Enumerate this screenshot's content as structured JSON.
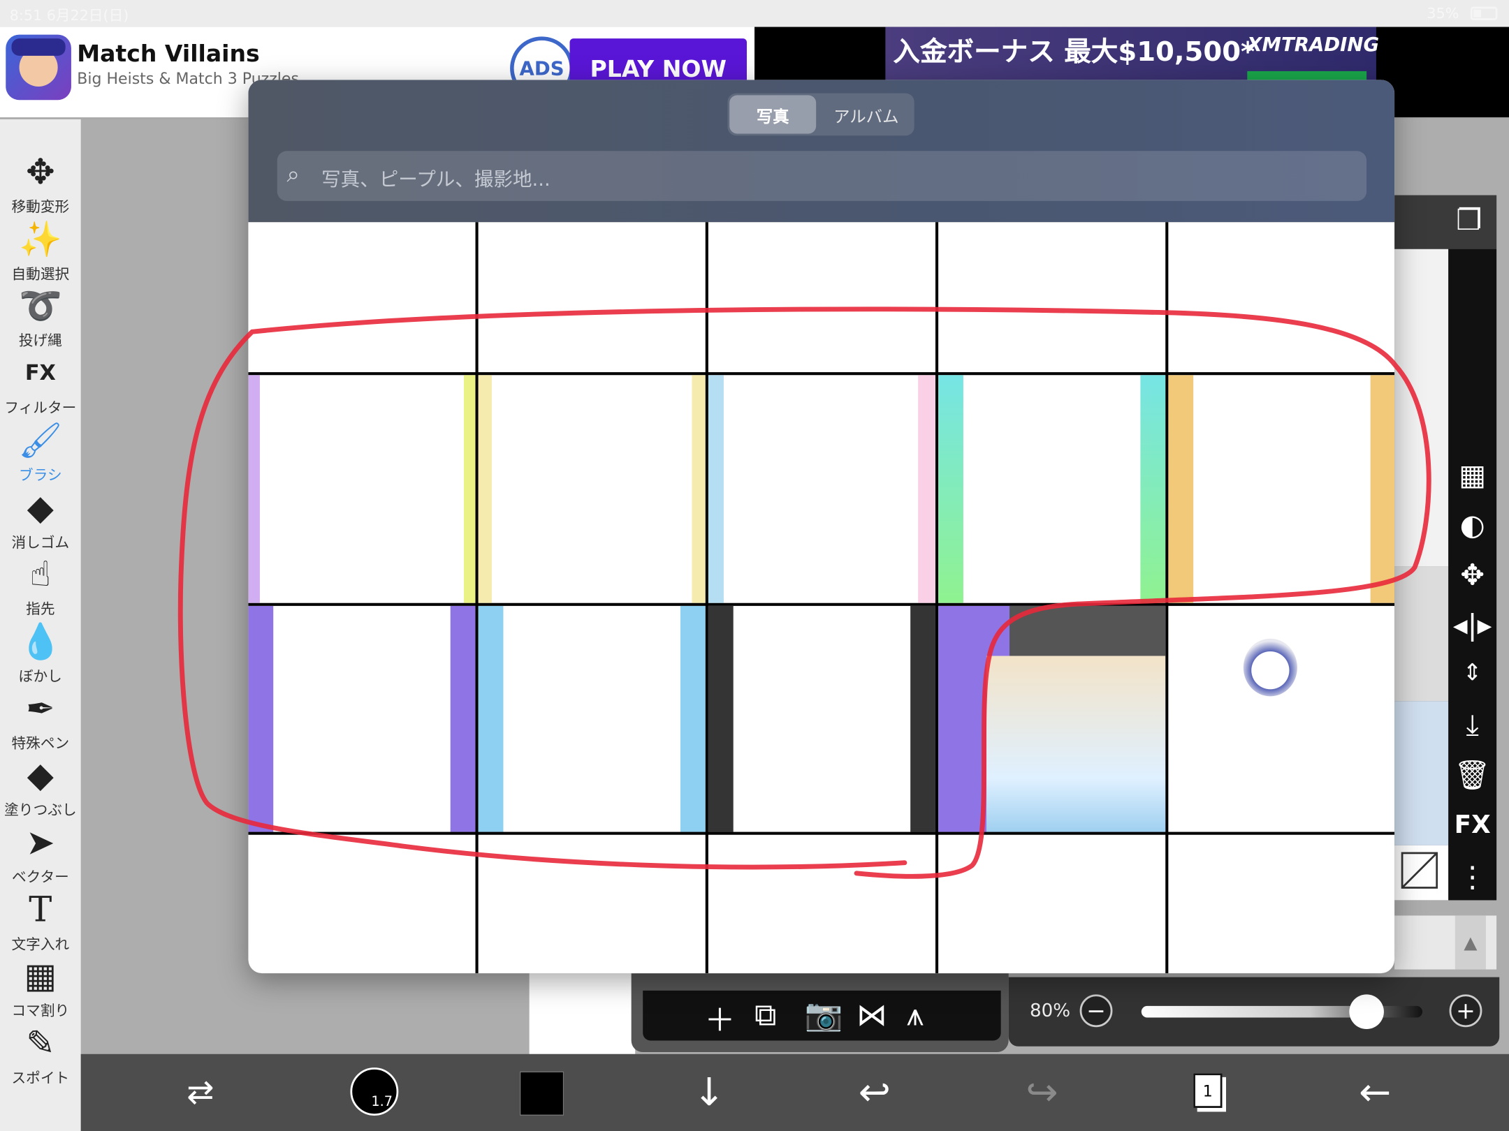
{
  "status_bar": {
    "time_date": "8:51  6月22日(日)",
    "battery_text": "35%"
  },
  "ad_left": {
    "title": "Match Villains",
    "subtitle": "Big Heists & Match 3 Puzzles",
    "ads_badge": "ADS",
    "cta": "PLAY NOW"
  },
  "ad_right": {
    "headline": "入金ボーナス 最大$10,500*",
    "brand": "XMTRADING"
  },
  "tools": [
    {
      "name": "move-transform",
      "label": "移動変形",
      "icon": "✥"
    },
    {
      "name": "auto-select",
      "label": "自動選択",
      "icon": "✨"
    },
    {
      "name": "lasso",
      "label": "投げ縄",
      "icon": "➰"
    },
    {
      "name": "filter",
      "label": "フィルター",
      "icon": "FX"
    },
    {
      "name": "brush",
      "label": "ブラシ",
      "icon": "🖌"
    },
    {
      "name": "eraser",
      "label": "消しゴム",
      "icon": "◆"
    },
    {
      "name": "finger",
      "label": "指先",
      "icon": "☝"
    },
    {
      "name": "blur",
      "label": "ぼかし",
      "icon": "💧"
    },
    {
      "name": "special-pen",
      "label": "特殊ペン",
      "icon": "✒"
    },
    {
      "name": "fill",
      "label": "塗りつぶし",
      "icon": "◆"
    },
    {
      "name": "vector",
      "label": "ベクター",
      "icon": "➤"
    },
    {
      "name": "text",
      "label": "文字入れ",
      "icon": "T"
    },
    {
      "name": "panel-split",
      "label": "コマ割り",
      "icon": "▦"
    },
    {
      "name": "eyedropper",
      "label": "スポイト",
      "icon": "✎"
    }
  ],
  "picker": {
    "tab_photos": "写真",
    "tab_albums": "アルバム",
    "search_placeholder": "写真、ピープル、撮影地..."
  },
  "layer_panel": {
    "fx_label": "FX",
    "opacity": "80%",
    "opacity_value": 0.8
  },
  "brush": {
    "size": "1.7"
  },
  "pages": {
    "current": "1"
  },
  "colors": {
    "accent": "#3a8ee6",
    "primary": "#000000",
    "ad_cta": "#5a16d6",
    "annotation": "#e8283a"
  }
}
